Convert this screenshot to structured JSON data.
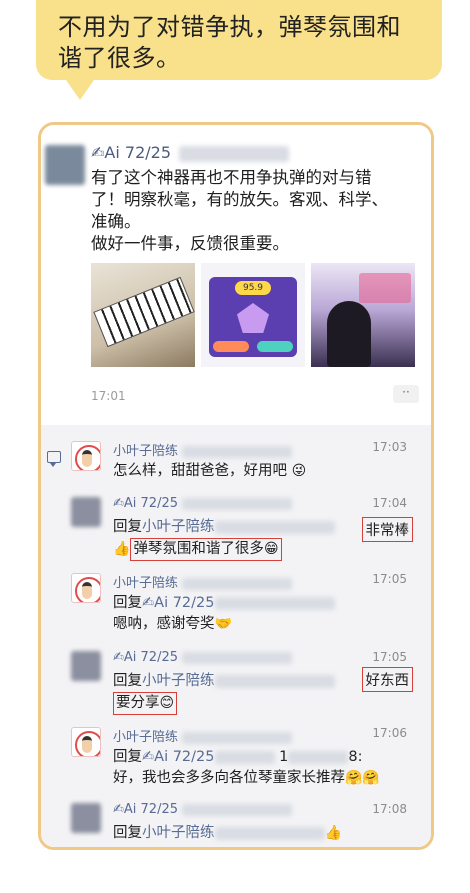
{
  "callout": {
    "line1": "不用为了对错争执，弹琴氛围和",
    "line2": "谐了很多。"
  },
  "post": {
    "author": "✍Ai 72/25",
    "lines": [
      "有了这个神器再也不用争执弹的对与错",
      "了！明察秋毫，有的放矢。客观、科学、",
      "准确。",
      "做好一件事，反馈很重要。"
    ],
    "app_score": "95.9",
    "time": "17:01",
    "more_label": "··"
  },
  "comments": [
    {
      "author": "小叶子陪练",
      "time": "17:03",
      "text": "怎么样，甜甜爸爸，好用吧",
      "emoji": "😜"
    },
    {
      "author": "✍Ai 72/25",
      "time": "17:04",
      "reply_prefix": "回复",
      "reply_to": "小叶子陪练",
      "highlight": "非常棒",
      "emoji_left": "👍",
      "boxed_text": "弹琴氛围和谐了很多",
      "emoji_right": "😁"
    },
    {
      "author": "小叶子陪练",
      "time": "17:05",
      "reply_prefix": "回复",
      "reply_to": "✍Ai 72/25",
      "text": "嗯呐，感谢夸奖",
      "emoji": "🤝"
    },
    {
      "author": "✍Ai 72/25",
      "time": "17:05",
      "reply_prefix": "回复",
      "reply_to": "小叶子陪练",
      "highlight": "好东西",
      "boxed_text": "要分享",
      "emoji": "😊"
    },
    {
      "author": "小叶子陪练",
      "time": "17:06",
      "reply_prefix": "回复",
      "reply_to": "✍Ai 72/25",
      "partial": "1",
      "partial_end": "8:",
      "text": "好，我也会多多向各位琴童家长推荐",
      "emoji": "🤗🤗"
    },
    {
      "author": "✍Ai 72/25",
      "time": "17:08",
      "reply_prefix": "回复",
      "reply_to": "小叶子陪练",
      "emoji": "👍"
    }
  ]
}
